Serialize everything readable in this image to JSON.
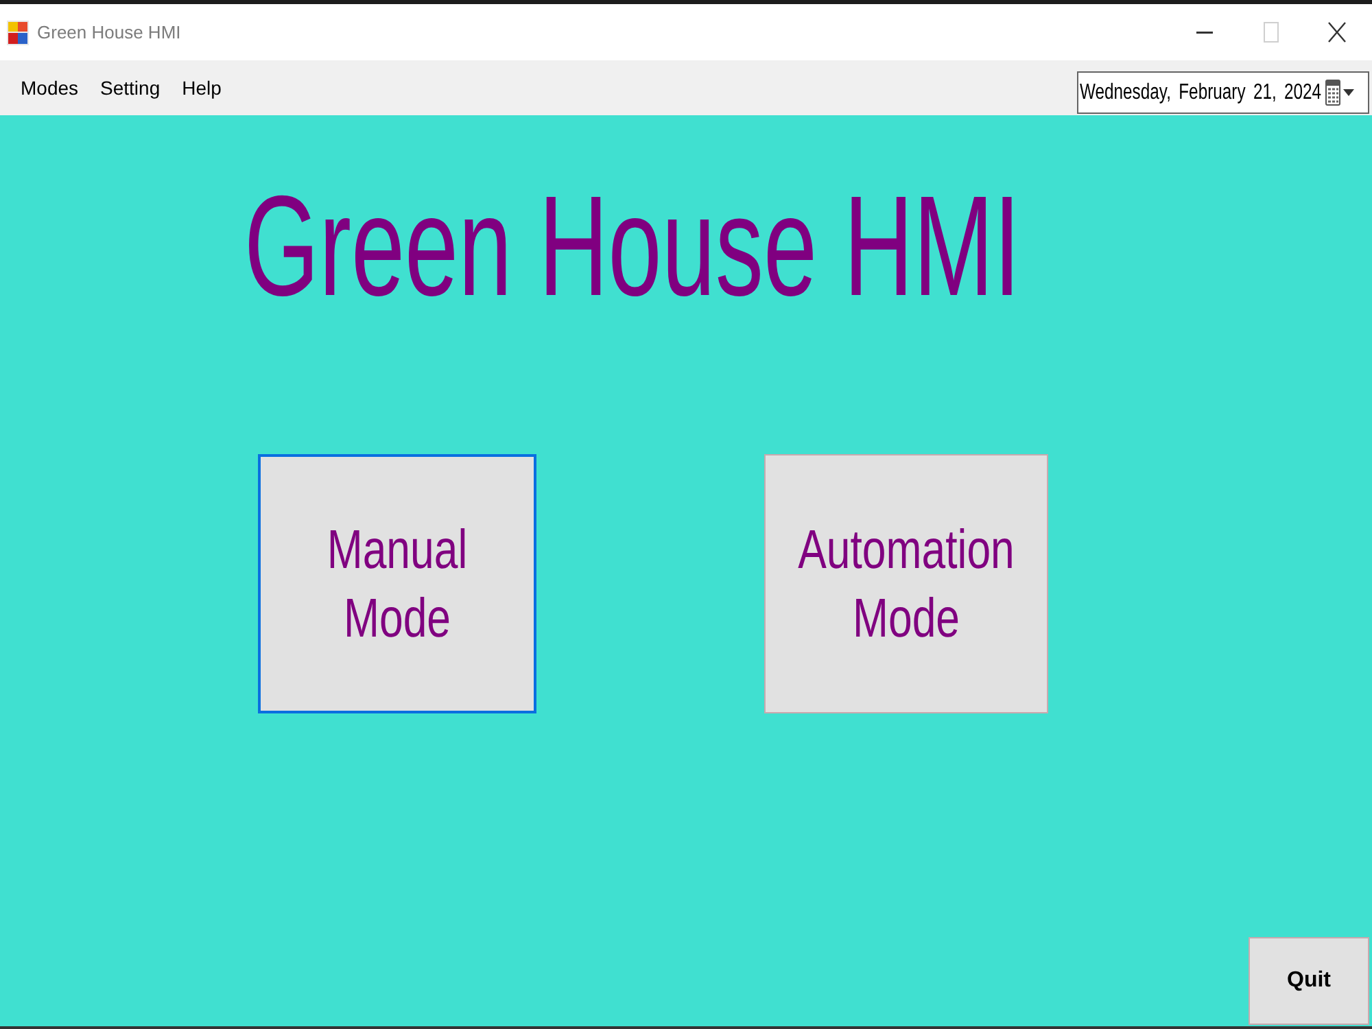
{
  "window": {
    "title": "Green House HMI",
    "controls": [
      {
        "kind": "minimize",
        "disabled": false
      },
      {
        "kind": "maximize",
        "disabled": true
      },
      {
        "kind": "close",
        "disabled": false
      }
    ]
  },
  "menu": [
    "Modes",
    "Setting",
    "Help"
  ],
  "date_picker": {
    "value": "Wednesday, February 21, 2024"
  },
  "heading": "Green House HMI",
  "mode_buttons": [
    {
      "label": "Manual Mode",
      "focused": true
    },
    {
      "label": "Automation Mode",
      "focused": false
    }
  ],
  "quit_button": {
    "label": "Quit"
  }
}
